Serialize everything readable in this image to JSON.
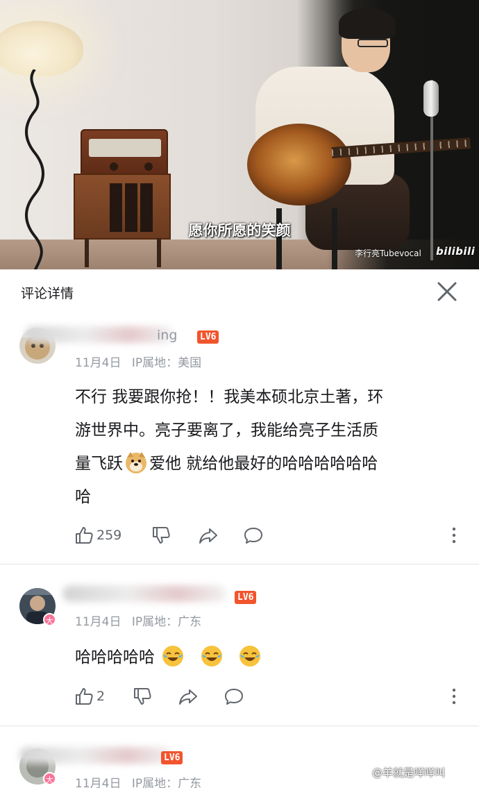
{
  "video": {
    "subtitle": "愿你所愿的笑颜",
    "author_watermark": "李行亮Tubevocal",
    "logo_text": "bilibili"
  },
  "panel": {
    "title": "评论详情",
    "close_icon": "close-icon"
  },
  "comments": [
    {
      "username_visible": "ing",
      "level": "LV6",
      "date": "11月4日",
      "location": "IP属地：美国",
      "content_lines": [
        "不行 我要跟你抢！！我美本硕北京土著，环",
        "游世界中。亮子要离了，我能给亮子生活质",
        "爱他 就给他最好的哈哈哈哈哈哈",
        "哈"
      ],
      "content_line3_prefix": "量飞跃",
      "likes": "259"
    },
    {
      "username_visible": "",
      "level": "LV6",
      "badge": "大",
      "date": "11月4日",
      "location": "IP属地：广东",
      "content": "哈哈哈哈哈",
      "likes": "2"
    },
    {
      "username_visible": "",
      "level": "LV6",
      "badge": "大",
      "date": "11月4日",
      "location": "IP属地：广东"
    }
  ],
  "footer": {
    "watermark": "@羊就是咩咩叫"
  },
  "colors": {
    "level_badge": "#f2542d",
    "pink_badge": "#fb7299",
    "meta_gray": "#9499a0",
    "icon_gray": "#61666d"
  }
}
